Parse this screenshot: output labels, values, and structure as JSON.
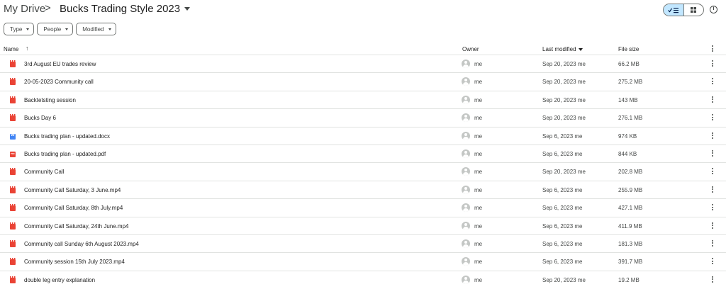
{
  "breadcrumb": {
    "root": "My Drive",
    "separator": ">",
    "current": "Bucks Trading Style 2023"
  },
  "filters": [
    {
      "label": "Type"
    },
    {
      "label": "People"
    },
    {
      "label": "Modified"
    }
  ],
  "columns": {
    "name": "Name",
    "owner": "Owner",
    "modified": "Last modified",
    "size": "File size"
  },
  "sort": {
    "column": "Last modified",
    "direction": "descending"
  },
  "view": {
    "selected": "list"
  },
  "colors": {
    "accent_toggle": "#c2e7ff",
    "video_icon": "#ea4335",
    "doc_icon": "#4285f4",
    "pdf_icon": "#ea4335",
    "divider": "#e1e3e1"
  },
  "files": [
    {
      "name": "3rd August EU trades review",
      "type": "video",
      "owner": "me",
      "modified": "Sep 20, 2023 me",
      "size": "66.2 MB"
    },
    {
      "name": "20-05-2023 Community call",
      "type": "video",
      "owner": "me",
      "modified": "Sep 20, 2023 me",
      "size": "275.2 MB"
    },
    {
      "name": "Backtetsting session",
      "type": "video",
      "owner": "me",
      "modified": "Sep 20, 2023 me",
      "size": "143 MB"
    },
    {
      "name": "Bucks Day 6",
      "type": "video",
      "owner": "me",
      "modified": "Sep 20, 2023 me",
      "size": "276.1 MB"
    },
    {
      "name": "Bucks trading plan - updated.docx",
      "type": "docx",
      "owner": "me",
      "modified": "Sep 6, 2023 me",
      "size": "974 KB"
    },
    {
      "name": "Bucks trading plan - updated.pdf",
      "type": "pdf",
      "owner": "me",
      "modified": "Sep 6, 2023 me",
      "size": "844 KB"
    },
    {
      "name": "Community Call",
      "type": "video",
      "owner": "me",
      "modified": "Sep 20, 2023 me",
      "size": "202.8 MB"
    },
    {
      "name": "Community Call Saturday, 3 June.mp4",
      "type": "video",
      "owner": "me",
      "modified": "Sep 6, 2023 me",
      "size": "255.9 MB"
    },
    {
      "name": "Community Call Saturday, 8th July.mp4",
      "type": "video",
      "owner": "me",
      "modified": "Sep 6, 2023 me",
      "size": "427.1 MB"
    },
    {
      "name": "Community Call Saturday, 24th June.mp4",
      "type": "video",
      "owner": "me",
      "modified": "Sep 6, 2023 me",
      "size": "411.9 MB"
    },
    {
      "name": "Community call Sunday 6th August 2023.mp4",
      "type": "video",
      "owner": "me",
      "modified": "Sep 6, 2023 me",
      "size": "181.3 MB"
    },
    {
      "name": "Community session 15th July 2023.mp4",
      "type": "video",
      "owner": "me",
      "modified": "Sep 6, 2023 me",
      "size": "391.7 MB"
    },
    {
      "name": "double leg entry explanation",
      "type": "video",
      "owner": "me",
      "modified": "Sep 20, 2023 me",
      "size": "19.2 MB"
    }
  ]
}
